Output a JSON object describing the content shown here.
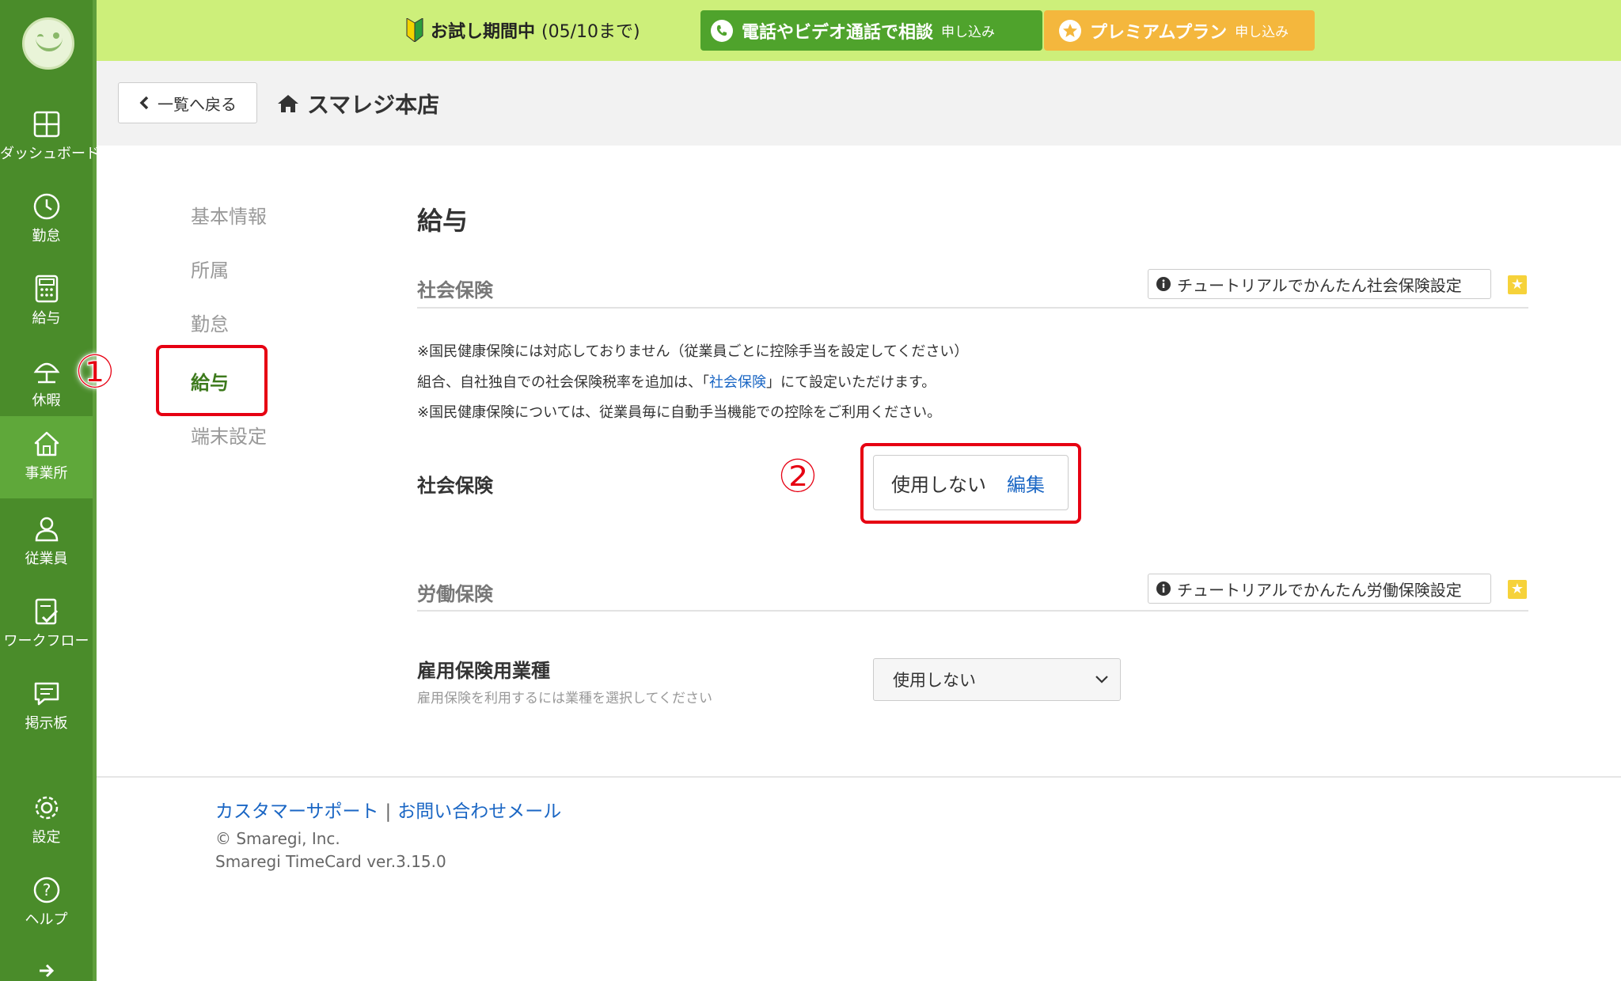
{
  "sidebar": {
    "items": [
      {
        "label": "ダッシュボード",
        "icon": "dashboard-icon"
      },
      {
        "label": "勤怠",
        "icon": "clock-icon"
      },
      {
        "label": "給与",
        "icon": "calculator-icon"
      },
      {
        "label": "休暇",
        "icon": "umbrella-icon"
      },
      {
        "label": "事業所",
        "icon": "home-icon"
      },
      {
        "label": "従業員",
        "icon": "person-icon"
      },
      {
        "label": "ワークフロー",
        "icon": "checklist-icon"
      },
      {
        "label": "掲示板",
        "icon": "chat-icon"
      },
      {
        "label": "設定",
        "icon": "gear-icon"
      },
      {
        "label": "ヘルプ",
        "icon": "help-icon"
      }
    ],
    "colors": {
      "bg": "#4a8c2a",
      "active": "#5fa83a"
    }
  },
  "topbar": {
    "trial_label": "お試し期間中",
    "trial_until": "(05/10まで)",
    "call_main": "電話やビデオ通話で相談",
    "call_sub": "申し込み",
    "premium_main": "プレミアムプラン",
    "premium_sub": "申し込み"
  },
  "header": {
    "back_label": "一覧へ戻る",
    "store_name": "スマレジ本店"
  },
  "subnav": {
    "items": [
      "基本情報",
      "所属",
      "勤怠",
      "給与",
      "端末設定"
    ],
    "selected": "給与"
  },
  "annotations": {
    "one": "①",
    "two": "②"
  },
  "main": {
    "title": "給与",
    "social": {
      "title": "社会保険",
      "tutorial": "チュートリアルでかんたん社会保険設定",
      "note1": "※国民健康保険には対応しておりません（従業員ごとに控除手当を設定してください）",
      "note2_pre": "組合、自社独自での社会保険税率を追加は、「",
      "note2_link": "社会保険",
      "note2_post": "」にて設定いただけます。",
      "note3": "※国民健康保険については、従業員毎に自動手当機能での控除をご利用ください。",
      "field_label": "社会保険",
      "value": "使用しない",
      "edit": "編集"
    },
    "labor": {
      "title": "労働保険",
      "tutorial": "チュートリアルでかんたん労働保険設定",
      "field_label": "雇用保険用業種",
      "help": "雇用保険を利用するには業種を選択してください",
      "select_value": "使用しない"
    }
  },
  "footer": {
    "support": "カスタマーサポート",
    "separator": "|",
    "mail": "お問い合わせメール",
    "copyright": "© Smaregi, Inc.",
    "version": "Smaregi TimeCard ver.3.15.0"
  }
}
